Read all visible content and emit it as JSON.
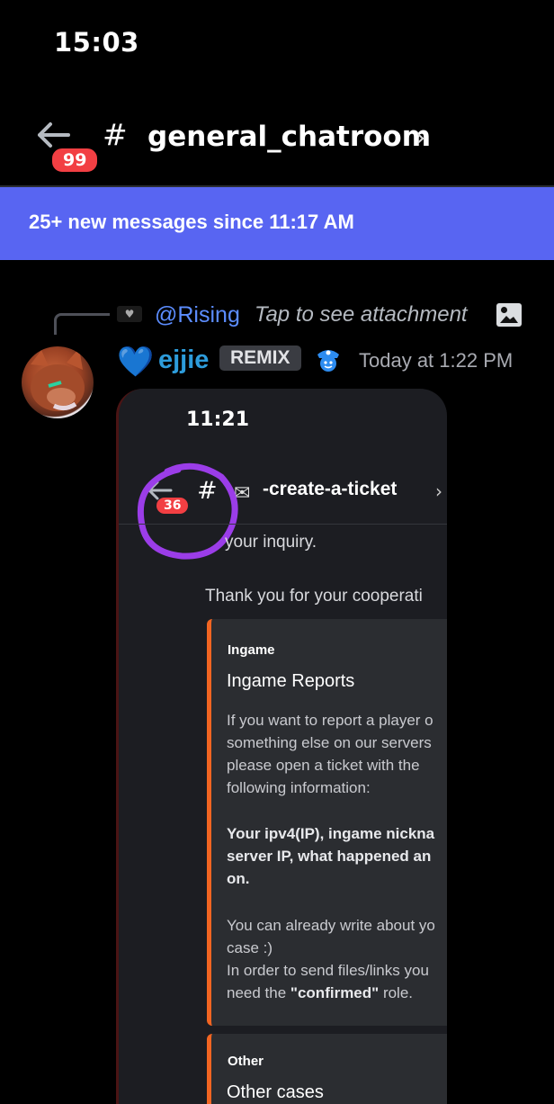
{
  "status_bar": {
    "time": "15:03"
  },
  "header": {
    "back_badge": "99",
    "hash": "#",
    "channel_name": "general_chatroom",
    "chevron": "›"
  },
  "new_messages_bar": {
    "text": "25+ new messages since 11:17 AM"
  },
  "message": {
    "reply": {
      "user": "@Rising",
      "text": "Tap to see attachment"
    },
    "heart": "💙",
    "username": "ejjie",
    "tag": "REMIX",
    "timestamp": "Today at 1:22 PM",
    "attachment": {
      "time": "11:21",
      "back_badge": "36",
      "hash": "#",
      "mail_glyph": "✉",
      "channel_title": "-create-a-ticket",
      "chevron": "›",
      "inquiry_text": "your inquiry.",
      "thanks_text": "Thank you for your cooperati",
      "embed1": {
        "label": "Ingame",
        "title": "Ingame Reports",
        "lines": [
          "If you want to report a player o",
          "something else on our servers",
          "please open a ticket with the",
          "following information:"
        ],
        "bold_lines": [
          "Your ipv4(IP), ingame nickna",
          "server IP, what happened an",
          "on."
        ],
        "extra_lines": [
          "You can already write about yo",
          "case :)",
          "In order to send files/links you"
        ],
        "role_prefix": "need the ",
        "role_bold": "\"confirmed\"",
        "role_suffix": " role."
      },
      "embed2": {
        "label": "Other",
        "title": "Other cases"
      }
    }
  }
}
